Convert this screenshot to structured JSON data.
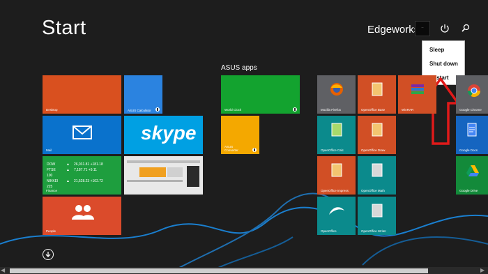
{
  "header": {
    "title": "Start",
    "user_name": "Edgeworks",
    "avatar_text": "—"
  },
  "power_menu": {
    "items": [
      {
        "label": "Sleep"
      },
      {
        "label": "Shut down"
      },
      {
        "label": "Restart"
      }
    ]
  },
  "groups": {
    "asus_label": "ASUS apps"
  },
  "tiles": {
    "desktop": "Desktop",
    "asus_calculator": "ASUS Calculator",
    "mail": "Mail",
    "skype": "skype",
    "finance": "Finance",
    "people": "People",
    "world_clock": "World Clock",
    "asus_converter": "ASUS Converter",
    "firefox": "Mozilla Firefox",
    "oo_base": "OpenOffice Base",
    "winrar": "WinRAR",
    "chrome": "Google Chrome",
    "oo_calc": "OpenOffice Calc",
    "oo_draw": "OpenOffice Draw",
    "gdocs": "Google Docs",
    "oo_impress": "OpenOffice Impress",
    "oo_math": "OpenOffice Math",
    "gdrive": "Google Drive",
    "openoffice": "OpenOffice",
    "oo_writer": "OpenOffice Writer"
  },
  "finance_rows": [
    {
      "name": "DOW",
      "arrow": "▲",
      "value": "26,031.81 +181.18"
    },
    {
      "name": "FTSE 100",
      "arrow": "▲",
      "value": "7,187.71 +9.11"
    },
    {
      "name": "NIKKEI 225",
      "arrow": "▲",
      "value": "21,528.23 +102.72"
    }
  ],
  "colors": {
    "background": "#1d1d1d",
    "desktop_tile": "#d9501f",
    "calculator_tile": "#2b83e0",
    "mail_tile": "#0a72cc",
    "skype_tile": "#00a0e3",
    "finance_tile": "#1e9e3e",
    "people_tile": "#db4b2b",
    "world_clock_tile": "#13a32f",
    "converter_tile": "#f4a800",
    "firefox_tile": "#5f6064",
    "openoffice_orange": "#d14f25",
    "openoffice_teal": "#0b8a8c",
    "chrome_tile": "#5f6064",
    "gdocs_tile": "#1565c0",
    "gdrive_tile": "#138a3a",
    "swirl": "#1a7fcf",
    "annotation_arrow": "#e01a1a"
  }
}
